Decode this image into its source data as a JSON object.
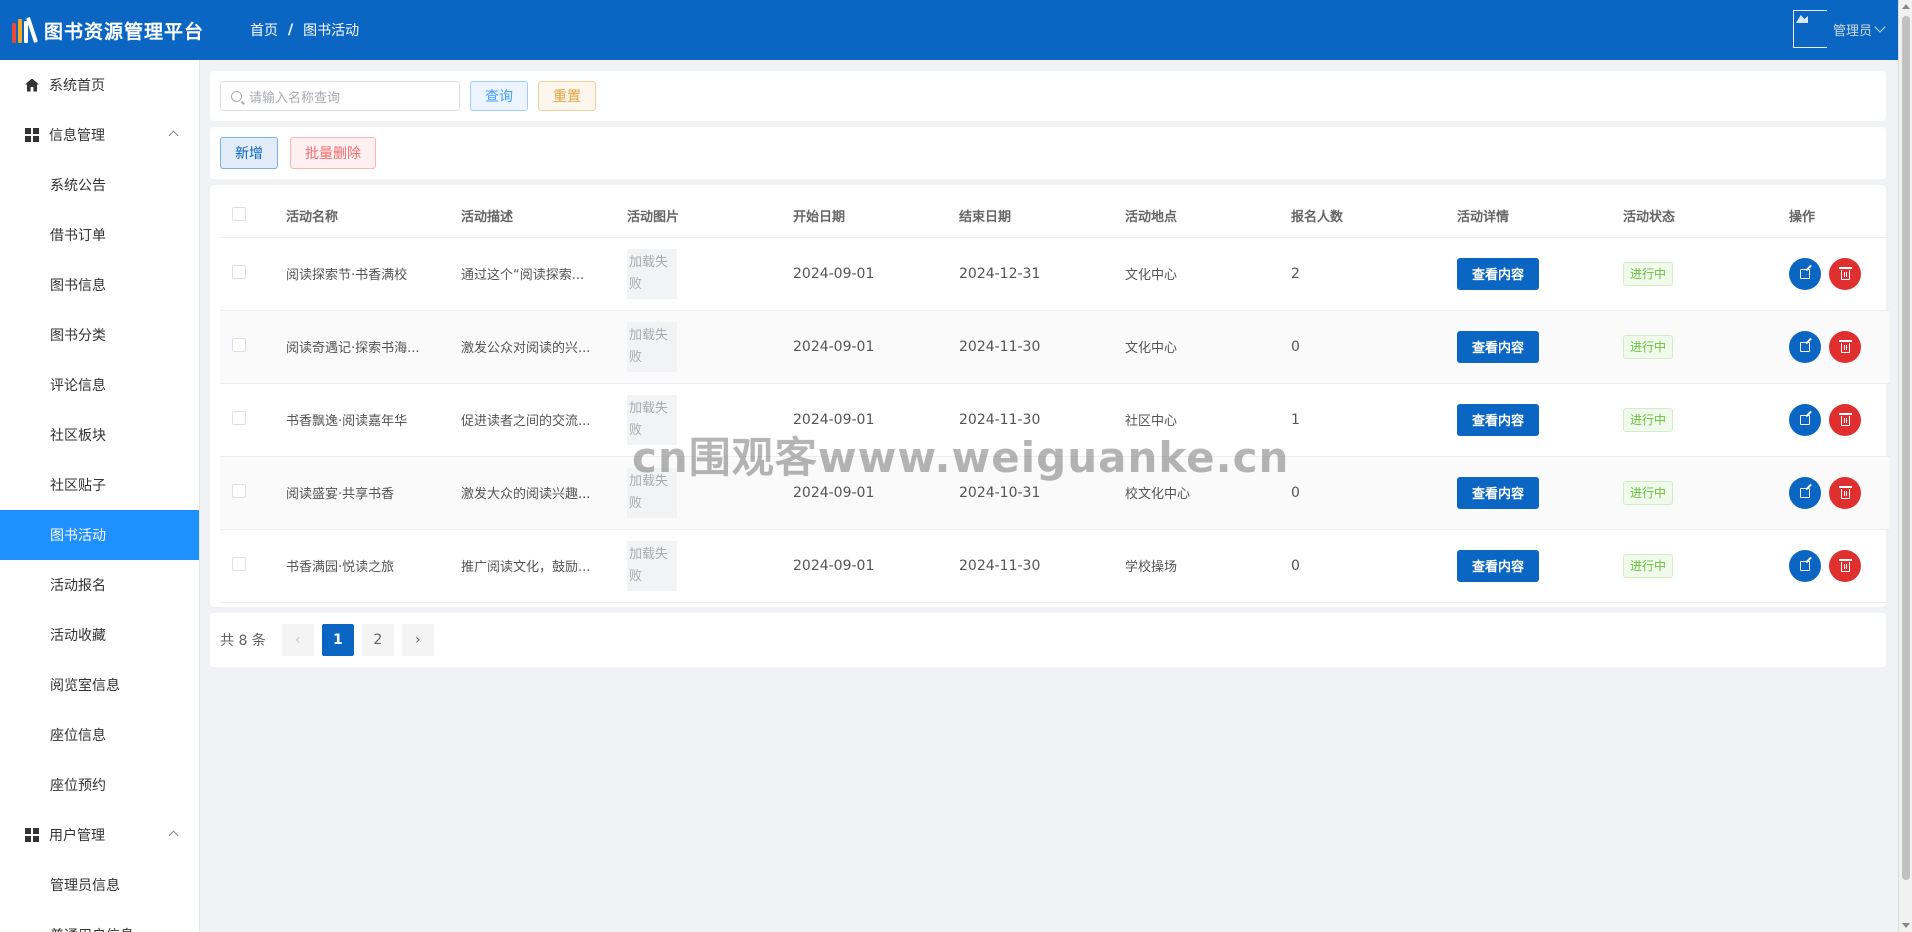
{
  "header": {
    "title": "图书资源管理平台",
    "breadcrumb": [
      "首页",
      "图书活动"
    ],
    "breadcrumb_sep": "/",
    "user": "管理员",
    "logo_colors": [
      "#e84b3c",
      "#f5a623",
      "#ffffff",
      "#ffffff"
    ]
  },
  "sidebar": {
    "home": "系统首页",
    "info_group": "信息管理",
    "info_items": [
      "系统公告",
      "借书订单",
      "图书信息",
      "图书分类",
      "评论信息",
      "社区板块",
      "社区贴子",
      "图书活动",
      "活动报名",
      "活动收藏",
      "阅览室信息",
      "座位信息",
      "座位预约"
    ],
    "active_item": "图书活动",
    "user_group": "用户管理",
    "user_items": [
      "管理员信息",
      "普通用户信息"
    ]
  },
  "search": {
    "placeholder": "请输入名称查询",
    "query_label": "查询",
    "reset_label": "重置"
  },
  "actions": {
    "add_label": "新增",
    "batch_delete_label": "批量删除"
  },
  "table": {
    "headers": [
      "活动名称",
      "活动描述",
      "活动图片",
      "开始日期",
      "结束日期",
      "活动地点",
      "报名人数",
      "活动详情",
      "活动状态",
      "操作"
    ],
    "rows": [
      {
        "name": "阅读探索节·书香满校",
        "desc": "通过这个“阅读探索...",
        "image": "加载失败",
        "start": "2024-09-01",
        "end": "2024-12-31",
        "place": "文化中心",
        "count": "2",
        "detail": "查看内容",
        "status": "进行中"
      },
      {
        "name": "阅读奇遇记·探索书海...",
        "desc": "激发公众对阅读的兴...",
        "image": "加载失败",
        "start": "2024-09-01",
        "end": "2024-11-30",
        "place": "文化中心",
        "count": "0",
        "detail": "查看内容",
        "status": "进行中"
      },
      {
        "name": "书香飘逸·阅读嘉年华",
        "desc": "促进读者之间的交流...",
        "image": "加载失败",
        "start": "2024-09-01",
        "end": "2024-11-30",
        "place": "社区中心",
        "count": "1",
        "detail": "查看内容",
        "status": "进行中"
      },
      {
        "name": "阅读盛宴·共享书香",
        "desc": "激发大众的阅读兴趣...",
        "image": "加载失败",
        "start": "2024-09-01",
        "end": "2024-10-31",
        "place": "校文化中心",
        "count": "0",
        "detail": "查看内容",
        "status": "进行中"
      },
      {
        "name": "书香满园·悦读之旅",
        "desc": "推广阅读文化，鼓励...",
        "image": "加载失败",
        "start": "2024-09-01",
        "end": "2024-11-30",
        "place": "学校操场",
        "count": "0",
        "detail": "查看内容",
        "status": "进行中"
      }
    ]
  },
  "pagination": {
    "total_label": "共 8 条",
    "prev": "‹",
    "pages": [
      "1",
      "2"
    ],
    "current": "1",
    "next": "›"
  },
  "watermark": "cn围观客www.weiguanke.cn"
}
